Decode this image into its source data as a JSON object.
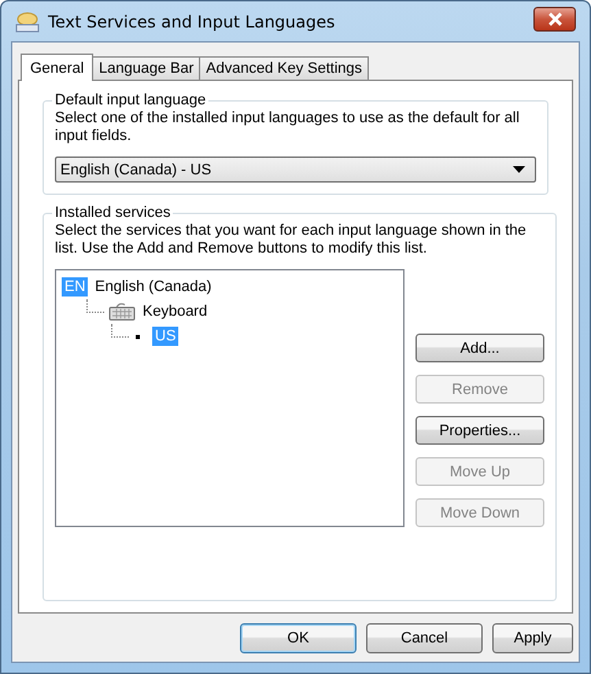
{
  "window": {
    "title": "Text Services and Input Languages"
  },
  "tabs": [
    {
      "label": "General",
      "selected": true
    },
    {
      "label": "Language Bar",
      "selected": false
    },
    {
      "label": "Advanced Key Settings",
      "selected": false
    }
  ],
  "default_input_language": {
    "heading": "Default input language",
    "description": "Select one of the installed input languages to use as the default for all input fields.",
    "dropdown": {
      "value": "English (Canada) - US"
    }
  },
  "installed_services": {
    "heading": "Installed services",
    "description": "Select the services that you want for each input language shown in the list. Use the Add and Remove buttons to modify this list.",
    "tree": [
      {
        "kind": "language",
        "badge": "EN",
        "label": "English (Canada)",
        "selected": false,
        "children": [
          {
            "kind": "category",
            "label": "Keyboard",
            "selected": false,
            "children": [
              {
                "kind": "service",
                "label": "US",
                "selected": true
              }
            ]
          }
        ]
      }
    ],
    "buttons": [
      {
        "label": "Add...",
        "disabled": false
      },
      {
        "label": "Remove",
        "disabled": true
      },
      {
        "label": "Properties...",
        "disabled": false
      },
      {
        "label": "Move Up",
        "disabled": true
      },
      {
        "label": "Move Down",
        "disabled": true
      }
    ]
  },
  "footer_buttons": [
    {
      "label": "OK",
      "default": true
    },
    {
      "label": "Cancel",
      "default": false
    },
    {
      "label": "Apply",
      "default": false
    }
  ]
}
